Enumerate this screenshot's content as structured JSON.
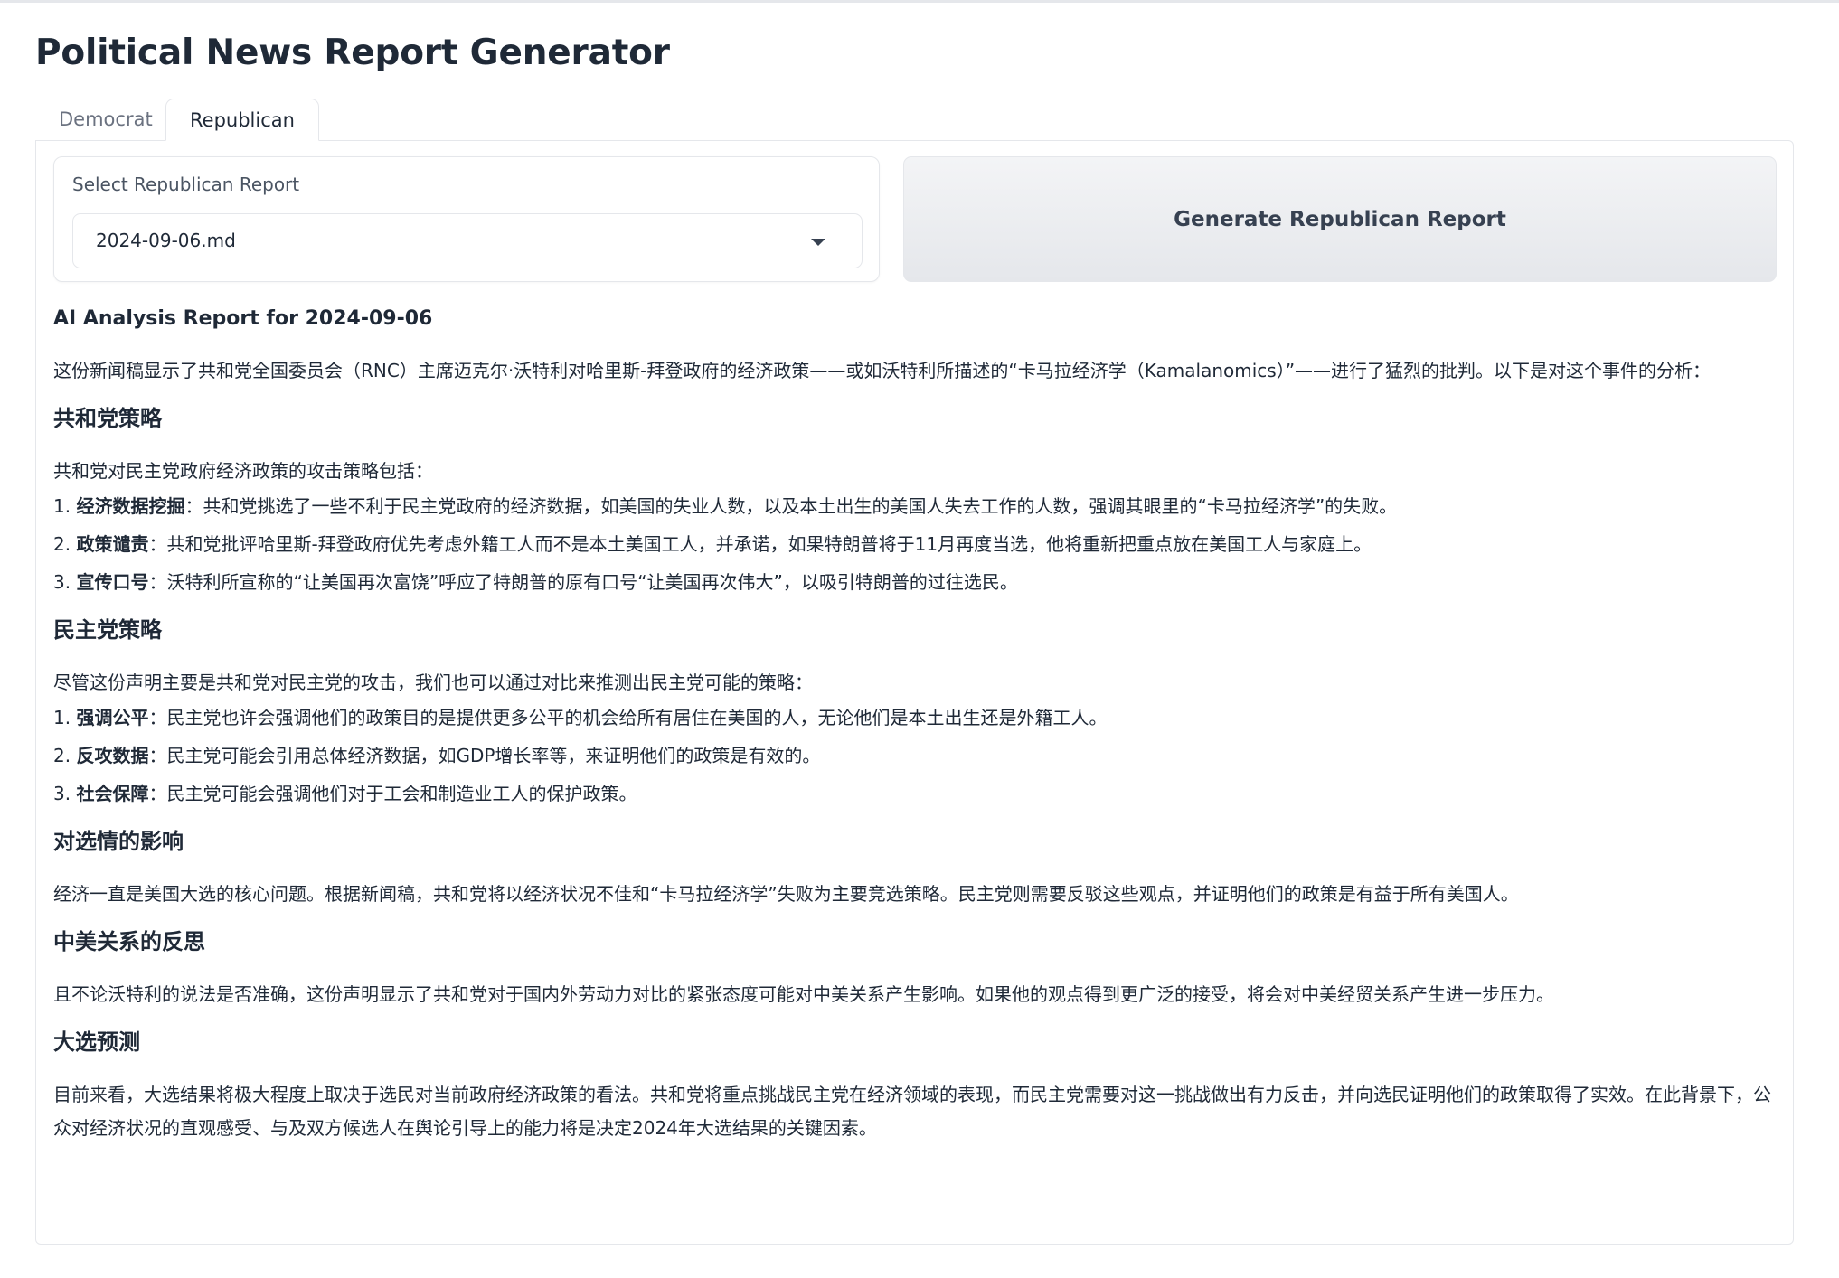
{
  "app": {
    "title": "Political News Report Generator"
  },
  "tabs": [
    {
      "label": "Democrat",
      "active": false
    },
    {
      "label": "Republican",
      "active": true
    }
  ],
  "selector": {
    "label": "Select Republican Report",
    "value": "2024-09-06.md"
  },
  "generate_button": {
    "label": "Generate Republican Report"
  },
  "report": {
    "heading": "AI Analysis Report for 2024-09-06",
    "intro": "这份新闻稿显示了共和党全国委员会（RNC）主席迈克尔·沃特利对哈里斯-拜登政府的经济政策——或如沃特利所描述的“卡马拉经济学（Kamalanomics）”——进行了猛烈的批判。以下是对这个事件的分析：",
    "sections": {
      "rep": {
        "title": "共和党策略",
        "lead": "共和党对民主党政府经济政策的攻击策略包括：",
        "items": [
          {
            "num": "1.",
            "term": "经济数据挖掘",
            "text": "：共和党挑选了一些不利于民主党政府的经济数据，如美国的失业人数，以及本土出生的美国人失去工作的人数，强调其眼里的“卡马拉经济学”的失败。"
          },
          {
            "num": "2.",
            "term": "政策谴责",
            "text": "：共和党批评哈里斯-拜登政府优先考虑外籍工人而不是本土美国工人，并承诺，如果特朗普将于11月再度当选，他将重新把重点放在美国工人与家庭上。"
          },
          {
            "num": "3.",
            "term": "宣传口号",
            "text": "：沃特利所宣称的“让美国再次富饶”呼应了特朗普的原有口号“让美国再次伟大”，以吸引特朗普的过往选民。"
          }
        ]
      },
      "dem": {
        "title": "民主党策略",
        "lead": "尽管这份声明主要是共和党对民主党的攻击，我们也可以通过对比来推测出民主党可能的策略：",
        "items": [
          {
            "num": "1.",
            "term": "强调公平",
            "text": "：民主党也许会强调他们的政策目的是提供更多公平的机会给所有居住在美国的人，无论他们是本土出生还是外籍工人。"
          },
          {
            "num": "2.",
            "term": "反攻数据",
            "text": "：民主党可能会引用总体经济数据，如GDP增长率等，来证明他们的政策是有效的。"
          },
          {
            "num": "3.",
            "term": "社会保障",
            "text": "：民主党可能会强调他们对于工会和制造业工人的保护政策。"
          }
        ]
      },
      "impact": {
        "title": "对选情的影响",
        "text": "经济一直是美国大选的核心问题。根据新闻稿，共和党将以经济状况不佳和“卡马拉经济学”失败为主要竞选策略。民主党则需要反驳这些观点，并证明他们的政策是有益于所有美国人。"
      },
      "china": {
        "title": "中美关系的反思",
        "text": "且不论沃特利的说法是否准确，这份声明显示了共和党对于国内外劳动力对比的紧张态度可能对中美关系产生影响。如果他的观点得到更广泛的接受，将会对中美经贸关系产生进一步压力。"
      },
      "forecast": {
        "title": "大选预测",
        "text": "目前来看，大选结果将极大程度上取决于选民对当前政府经济政策的看法。共和党将重点挑战民主党在经济领域的表现，而民主党需要对这一挑战做出有力反击，并向选民证明他们的政策取得了实效。在此背景下，公众对经济状况的直观感受、与及双方候选人在舆论引导上的能力将是决定2024年大选结果的关键因素。"
      }
    }
  }
}
